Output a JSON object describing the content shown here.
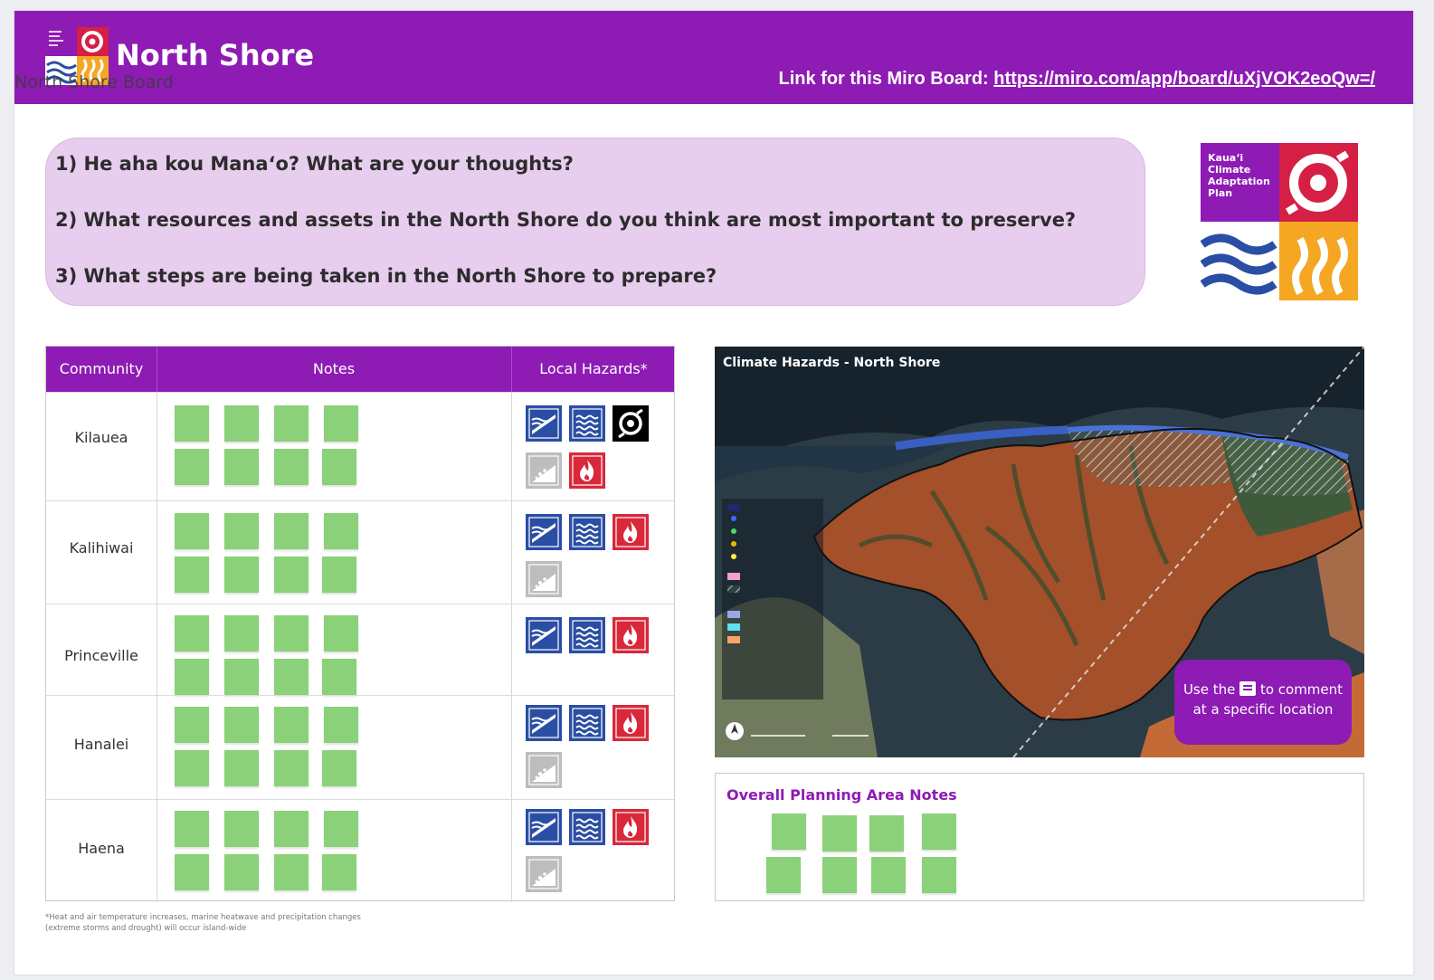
{
  "header": {
    "title": "North Shore",
    "board_label": "North Shore Board",
    "link_label": "Link for this Miro Board: ",
    "link_url": "https://miro.com/app/board/uXjVOK2eoQw=/"
  },
  "questions": [
    "1) He aha kou Mana‘o? What are your thoughts?",
    "2) What resources and assets in the North Shore do you think are most important to preserve?",
    "3) What steps are being taken in the North Shore to prepare?"
  ],
  "logo": {
    "line1": "Kaua‘i",
    "line2": "Climate",
    "line3": "Adaptation",
    "line4": "Plan"
  },
  "table": {
    "headers": {
      "community": "Community",
      "notes": "Notes",
      "hazards": "Local Hazards*"
    },
    "rows": [
      {
        "community": "Kilauea",
        "hazards": [
          "coastal-erosion",
          "flooding",
          "hurricane",
          "landslide",
          "wildfire"
        ]
      },
      {
        "community": "Kalihiwai",
        "hazards": [
          "coastal-erosion",
          "flooding",
          "wildfire",
          "landslide"
        ]
      },
      {
        "community": "Princeville",
        "hazards": [
          "coastal-erosion",
          "flooding",
          "wildfire"
        ]
      },
      {
        "community": "Hanalei",
        "hazards": [
          "coastal-erosion",
          "flooding",
          "wildfire",
          "landslide"
        ]
      },
      {
        "community": "Haena",
        "hazards": [
          "coastal-erosion",
          "flooding",
          "wildfire",
          "landslide"
        ]
      }
    ]
  },
  "map": {
    "title": "Climate Hazards - North Shore",
    "callout_pre": "Use the",
    "callout_post": "to comment",
    "callout_line2": "at a specific location"
  },
  "overall_notes": {
    "title": "Overall Planning Area Notes"
  },
  "footnote": "*Heat and air temperature increases, marine heatwave and precipitation changes (extreme storms and drought) will occur island-wide",
  "colors": {
    "brand_purple": "#8e1bb4",
    "question_bg": "#e7cdee",
    "sticky_green": "#8ad17a",
    "hazard_blue": "#2a4ea3",
    "hazard_red": "#d8283a",
    "logo_red": "#d61f45",
    "logo_orange": "#f5a623"
  }
}
